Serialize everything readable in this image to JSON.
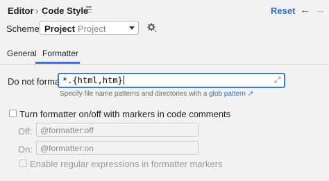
{
  "header": {
    "breadcrumb": [
      "Editor",
      "Code Style"
    ],
    "separator": "›",
    "reset_label": "Reset",
    "back_arrow": "←",
    "forward_arrow": "→"
  },
  "scheme": {
    "label": "Scheme:",
    "name": "Project",
    "type": "Project"
  },
  "tabs": [
    {
      "label": "General",
      "selected": false
    },
    {
      "label": "Formatter",
      "selected": true
    }
  ],
  "formatter": {
    "do_not_format_label": "Do not format:",
    "do_not_format_value": "*.{html,htm}",
    "hint_text": "Specify file name patterns and directories with a",
    "hint_link": "glob pattern ↗",
    "toggle_label": "Turn formatter on/off with markers in code comments",
    "toggle_checked": false,
    "off_label": "Off:",
    "off_placeholder": "@formatter:off",
    "on_label": "On:",
    "on_placeholder": "@formatter:on",
    "regex_label": "Enable regular expressions in formatter markers",
    "regex_checked": false
  },
  "colors": {
    "accent": "#3574f0",
    "link": "#2f6fd1",
    "background": "#f2f2f2"
  }
}
